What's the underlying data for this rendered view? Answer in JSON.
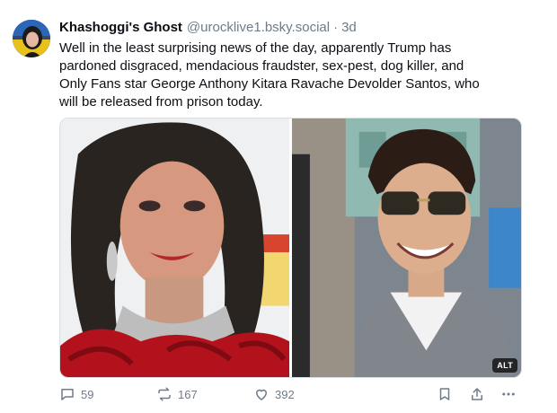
{
  "post": {
    "author": {
      "display_name": "Khashoggi's Ghost",
      "handle": "@urocklive1.bsky.social",
      "separator": "·",
      "time": "3d"
    },
    "text_lines": [
      "Well in the least surprising news of the day, apparently Trump has",
      "pardoned disgraced, mendacious fraudster, sex-pest, dog killer, and",
      "Only Fans star George Anthony Kitara Ravache Devolder Santos, who",
      "will be released from prison today."
    ],
    "media": {
      "alt_badge": "ALT",
      "images": [
        "photo-left",
        "photo-right"
      ]
    },
    "actions": {
      "reply_count": "59",
      "repost_count": "167",
      "like_count": "392"
    },
    "icons": {
      "reply": "comment-icon",
      "repost": "repost-icon",
      "like": "heart-icon",
      "bookmark": "bookmark-icon",
      "share": "share-icon",
      "more": "more-icon"
    },
    "colors": {
      "muted_text": "#6f7b8a",
      "text": "#0b0f14",
      "border": "#d9dee4"
    }
  }
}
